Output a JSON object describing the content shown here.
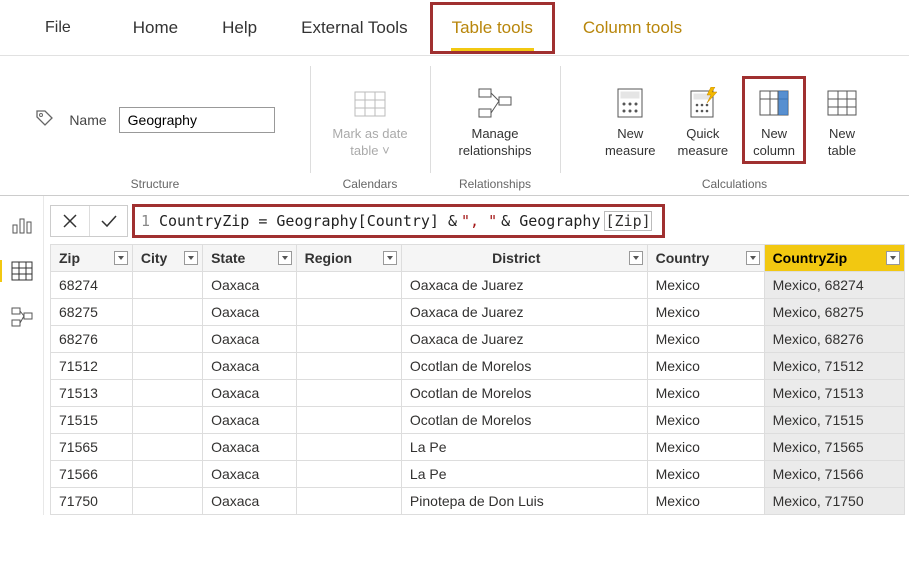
{
  "tabs": {
    "file": "File",
    "home": "Home",
    "help": "Help",
    "external": "External Tools",
    "table_tools": "Table tools",
    "column_tools": "Column tools"
  },
  "ribbon": {
    "name_label": "Name",
    "name_value": "Geography",
    "mark_line1": "Mark as date",
    "mark_line2": "table",
    "manage_line1": "Manage",
    "manage_line2": "relationships",
    "new_measure_line1": "New",
    "new_measure_line2": "measure",
    "quick_measure_line1": "Quick",
    "quick_measure_line2": "measure",
    "new_column_line1": "New",
    "new_column_line2": "column",
    "new_table_line1": "New",
    "new_table_line2": "table",
    "g_structure": "Structure",
    "g_calendars": "Calendars",
    "g_relationships": "Relationships",
    "g_calculations": "Calculations"
  },
  "formula": {
    "line_no": "1",
    "text_prefix": "CountryZip = Geography[Country] & ",
    "text_str": "\", \"",
    "text_mid": " & Geography",
    "text_col": "[Zip]"
  },
  "columns": [
    "Zip",
    "City",
    "State",
    "Region",
    "District",
    "Country",
    "CountryZip"
  ],
  "rows": [
    {
      "zip": "68274",
      "city": "",
      "state": "Oaxaca",
      "region": "",
      "district": "Oaxaca de Juarez",
      "country": "Mexico",
      "countryzip": "Mexico, 68274"
    },
    {
      "zip": "68275",
      "city": "",
      "state": "Oaxaca",
      "region": "",
      "district": "Oaxaca de Juarez",
      "country": "Mexico",
      "countryzip": "Mexico, 68275"
    },
    {
      "zip": "68276",
      "city": "",
      "state": "Oaxaca",
      "region": "",
      "district": "Oaxaca de Juarez",
      "country": "Mexico",
      "countryzip": "Mexico, 68276"
    },
    {
      "zip": "71512",
      "city": "",
      "state": "Oaxaca",
      "region": "",
      "district": "Ocotlan de Morelos",
      "country": "Mexico",
      "countryzip": "Mexico, 71512"
    },
    {
      "zip": "71513",
      "city": "",
      "state": "Oaxaca",
      "region": "",
      "district": "Ocotlan de Morelos",
      "country": "Mexico",
      "countryzip": "Mexico, 71513"
    },
    {
      "zip": "71515",
      "city": "",
      "state": "Oaxaca",
      "region": "",
      "district": "Ocotlan de Morelos",
      "country": "Mexico",
      "countryzip": "Mexico, 71515"
    },
    {
      "zip": "71565",
      "city": "",
      "state": "Oaxaca",
      "region": "",
      "district": "La Pe",
      "country": "Mexico",
      "countryzip": "Mexico, 71565"
    },
    {
      "zip": "71566",
      "city": "",
      "state": "Oaxaca",
      "region": "",
      "district": "La Pe",
      "country": "Mexico",
      "countryzip": "Mexico, 71566"
    },
    {
      "zip": "71750",
      "city": "",
      "state": "Oaxaca",
      "region": "",
      "district": "Pinotepa de Don Luis",
      "country": "Mexico",
      "countryzip": "Mexico, 71750"
    }
  ]
}
